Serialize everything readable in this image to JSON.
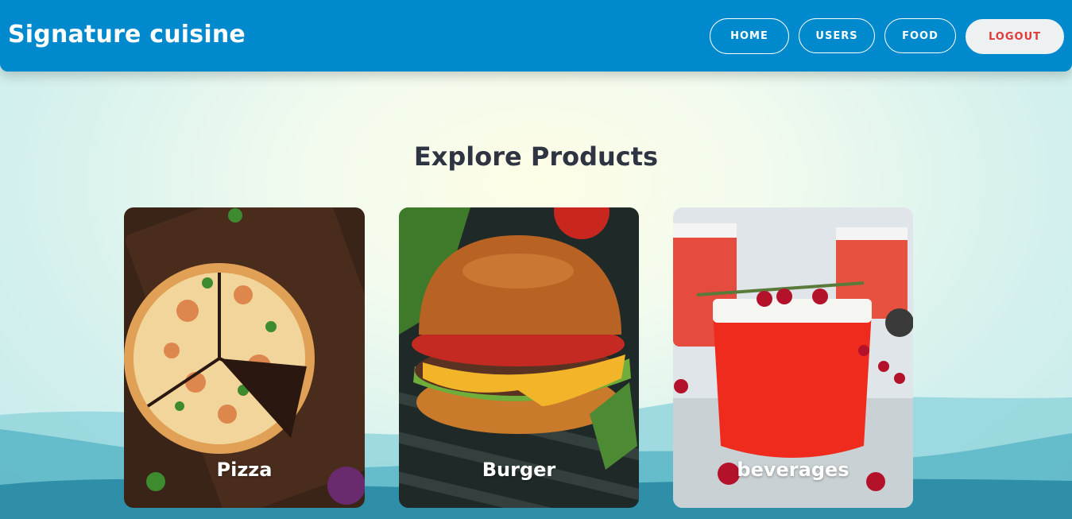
{
  "navbar": {
    "brand": "Signature cuisine",
    "links": [
      {
        "label": "HOME"
      },
      {
        "label": "USERS"
      },
      {
        "label": "FOOD"
      },
      {
        "label": "LOGOUT"
      }
    ]
  },
  "main": {
    "title": "Explore Products",
    "cards": [
      {
        "label": "Pizza",
        "image": "pizza-image"
      },
      {
        "label": "Burger",
        "image": "burger-image"
      },
      {
        "label": "beverages",
        "image": "beverage-image"
      }
    ]
  },
  "colors": {
    "navbar": "#0089cc",
    "logout_text": "#e03a3a",
    "title_text": "#2f3443"
  }
}
